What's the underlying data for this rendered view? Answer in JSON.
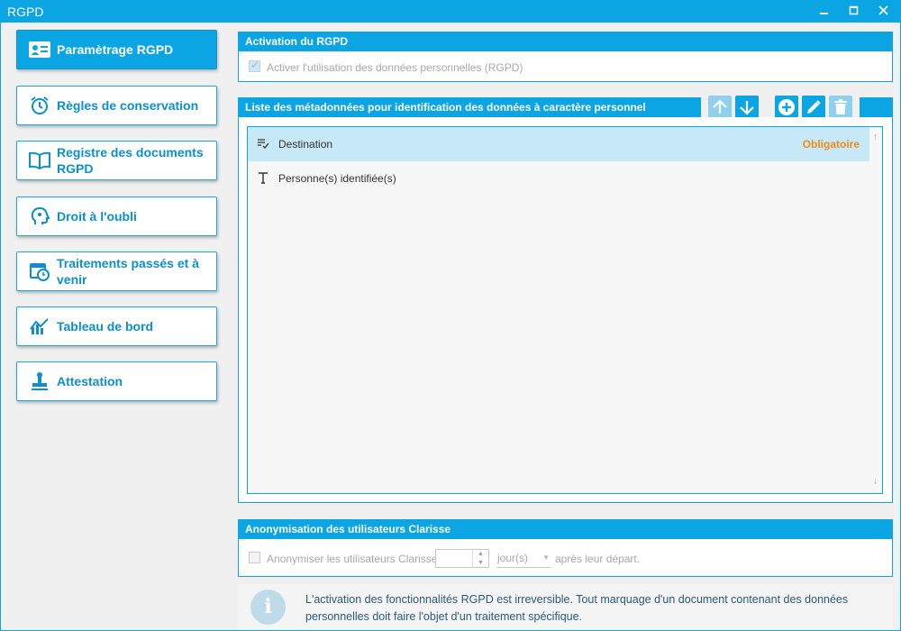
{
  "window": {
    "title": "RGPD",
    "controls": {
      "minimize": "🗕",
      "maximize": "🗖",
      "close": "✕"
    }
  },
  "colors": {
    "accent": "#0aa5e2",
    "active_nav": "#0aa5e2",
    "nav_text": "#0d8fcb",
    "mandatory": "#f08a18",
    "selected_row": "#c7e8f7"
  },
  "sidebar": {
    "items": [
      {
        "label": "Paramètrage RGPD",
        "icon": "id-card-icon",
        "active": true
      },
      {
        "label": "Règles de conservation",
        "icon": "alarm-clock-icon",
        "active": false
      },
      {
        "label": "Registre des documents RGPD",
        "icon": "open-book-icon",
        "active": false
      },
      {
        "label": "Droit à l'oubli",
        "icon": "head-profile-icon",
        "active": false
      },
      {
        "label": "Traitements passés et à venir",
        "icon": "calendar-clock-icon",
        "active": false
      },
      {
        "label": "Tableau de bord",
        "icon": "chart-trend-icon",
        "active": false
      },
      {
        "label": "Attestation",
        "icon": "stamp-icon",
        "active": false
      }
    ]
  },
  "activation": {
    "header": "Activation du RGPD",
    "checkbox_label": "Activer l'utilisation des données personnelles (RGPD)",
    "checked": true,
    "enabled": false
  },
  "metadata": {
    "header": "Liste des métadonnées pour identification des données à caractère personnel",
    "toolbar": {
      "move_up": "arrow-up-icon",
      "move_down": "arrow-down-icon",
      "add": "plus-circle-icon",
      "edit": "pencil-icon",
      "delete": "trash-icon"
    },
    "rows": [
      {
        "label": "Destination",
        "tag": "Obligatoire",
        "icon": "list-check-icon",
        "selected": true
      },
      {
        "label": "Personne(s) identifiée(s)",
        "tag": "",
        "icon": "text-type-icon",
        "selected": false
      }
    ]
  },
  "anonymisation": {
    "header": "Anonymisation des utilisateurs Clarisse",
    "checkbox_label": "Anonymiser les utilisateurs Clarisse",
    "checked": false,
    "days_value": "",
    "unit": "jour(s)",
    "suffix": "après leur départ."
  },
  "info": {
    "badge": "i",
    "message": "L'activation des fonctionnalités RGPD est irreversible. Tout marquage d'un document contenant des données personnelles doit faire l'objet d'un traitement spécifique."
  }
}
